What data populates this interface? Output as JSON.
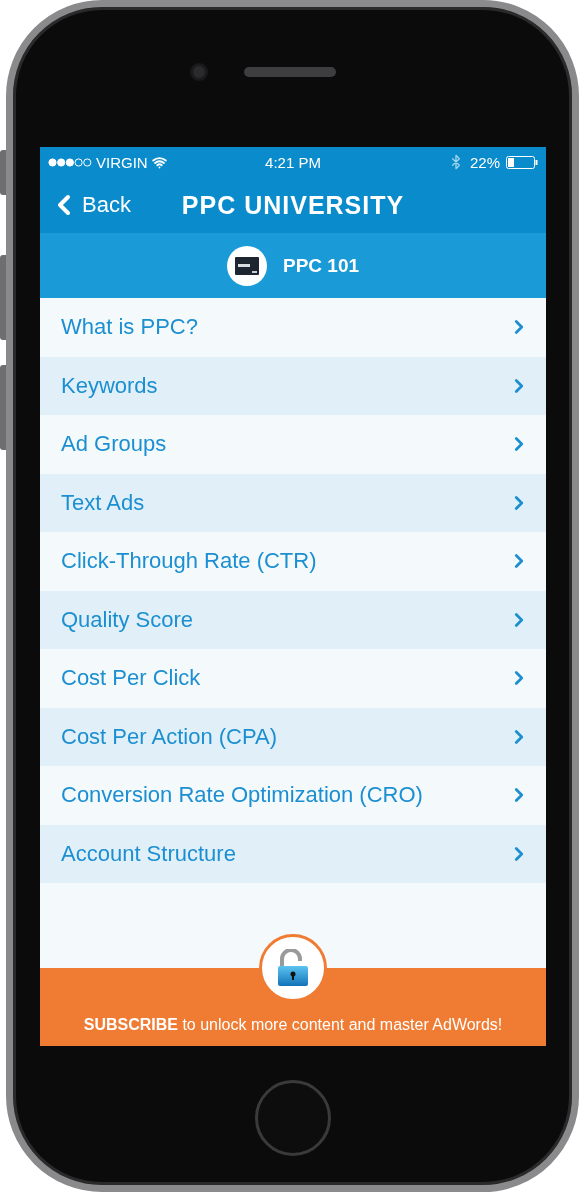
{
  "status_bar": {
    "carrier": "VIRGIN",
    "time": "4:21 PM",
    "battery": "22%"
  },
  "nav_bar": {
    "back": "Back",
    "title": "PPC UNIVERSITY"
  },
  "section": {
    "title": "PPC 101"
  },
  "items": [
    {
      "label": "What is PPC?"
    },
    {
      "label": "Keywords"
    },
    {
      "label": "Ad Groups"
    },
    {
      "label": "Text Ads"
    },
    {
      "label": "Click-Through Rate (CTR)"
    },
    {
      "label": "Quality Score"
    },
    {
      "label": "Cost Per Click"
    },
    {
      "label": "Cost Per Action (CPA)"
    },
    {
      "label": "Conversion Rate Optimization (CRO)"
    },
    {
      "label": "Account Structure"
    }
  ],
  "footer": {
    "text": "**SUBSCRIBE** to unlock more content and master AdWords!"
  }
}
